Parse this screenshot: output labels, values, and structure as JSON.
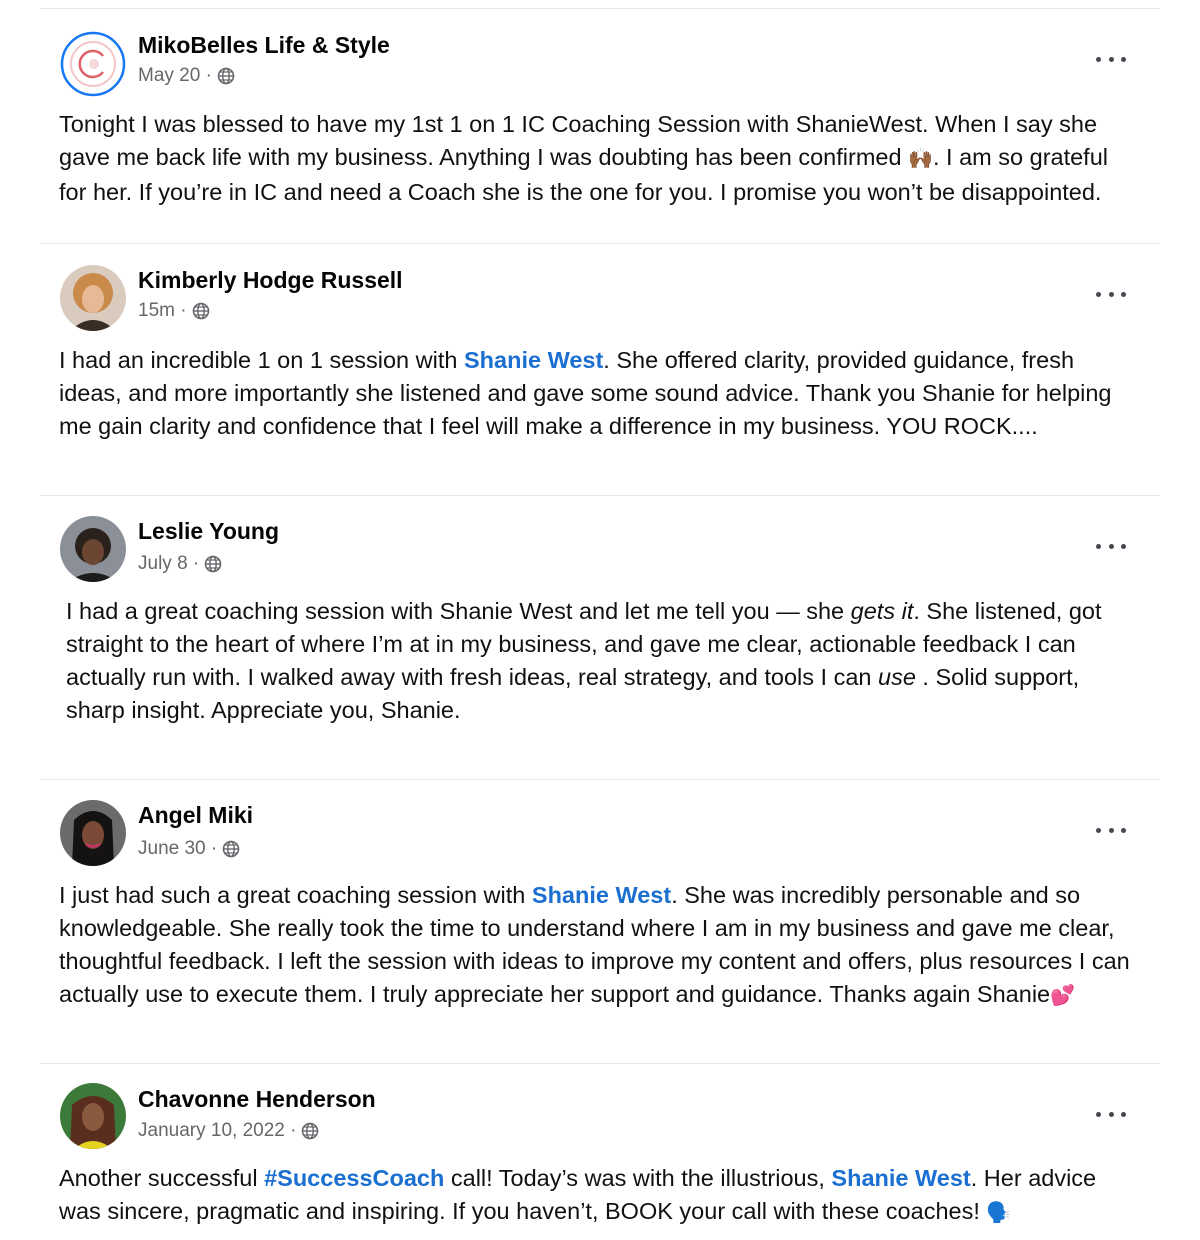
{
  "posts": [
    {
      "author": "MikoBelles Life & Style",
      "meta": "May 20 ·",
      "parts": [
        {
          "t": "Tonight I was blessed to have my 1st 1 on 1 IC Coaching Session with ShanieWest.  When I say she gave me back life with my business.  Anything I was doubting has been confirmed "
        },
        {
          "t": "🙌🏾",
          "emoji": true
        },
        {
          "t": ".  I am so grateful for her.  If you’re in IC and need a Coach she is the one for you.  I promise you won’t be disappointed."
        }
      ]
    },
    {
      "author": "Kimberly Hodge Russell",
      "meta": "15m ·",
      "parts": [
        {
          "t": "I had an incredible 1 on 1 session with "
        },
        {
          "t": "Shanie West",
          "link": true
        },
        {
          "t": ". She offered clarity, provided guidance, fresh ideas, and more importantly she listened and gave some sound advice. Thank you Shanie for helping me gain clarity and confidence that I feel will make a difference in my business.   YOU ROCK...."
        }
      ]
    },
    {
      "author": "Leslie Young",
      "meta": "July 8 ·",
      "parts": [
        {
          "t": "I had a great coaching session with Shanie West and let me tell you — she "
        },
        {
          "t": "gets it",
          "italic": true
        },
        {
          "t": ". She listened, got straight to the heart of where I’m at in my business, and gave me clear, actionable feedback I can actually run with. I walked away with fresh ideas, real strategy, and tools I can "
        },
        {
          "t": "use",
          "italic": true
        },
        {
          "t": " . Solid support, sharp insight. Appreciate you, Shanie."
        }
      ]
    },
    {
      "author": "Angel Miki",
      "meta": "June 30 ·",
      "parts": [
        {
          "t": "I just had such a great coaching session with "
        },
        {
          "t": "Shanie West",
          "link": true
        },
        {
          "t": ". She was incredibly personable and so knowledgeable. She really took the time to understand where I am in my business and gave me clear, thoughtful feedback. I left the session with ideas to improve my content and offers, plus resources I can actually use to execute them. I truly appreciate her support and guidance. Thanks again Shanie"
        },
        {
          "t": "💕",
          "emoji": true
        }
      ]
    },
    {
      "author": "Chavonne Henderson",
      "meta": "January 10, 2022 ·",
      "parts": [
        {
          "t": "Another successful "
        },
        {
          "t": "#SuccessCoach",
          "link": true
        },
        {
          "t": " call! Today’s was with the illustrious, "
        },
        {
          "t": "Shanie West",
          "link": true
        },
        {
          "t": ". Her advice was sincere, pragmatic and inspiring. If you haven’t, BOOK your call with these coaches! "
        },
        {
          "t": "🗣️",
          "emoji": true
        }
      ]
    }
  ]
}
